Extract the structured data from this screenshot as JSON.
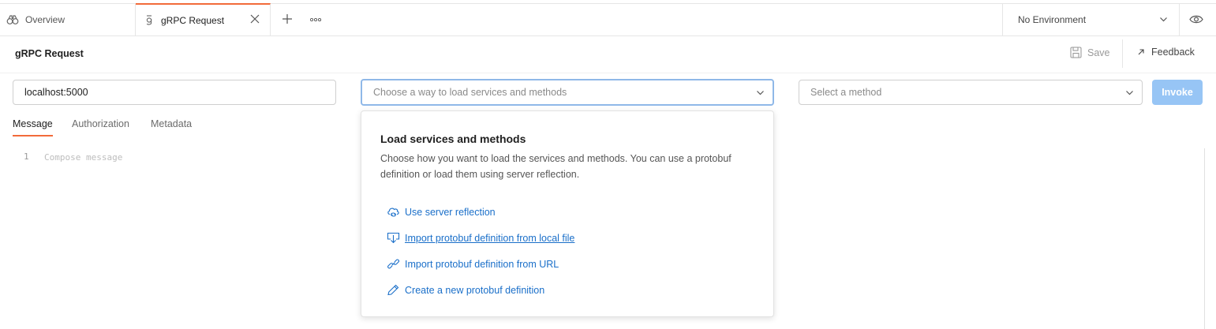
{
  "tabs": {
    "overview_label": "Overview",
    "active_label": "gRPC Request"
  },
  "environment": {
    "selected": "No Environment"
  },
  "request": {
    "title": "gRPC Request",
    "save_label": "Save",
    "feedback_label": "Feedback",
    "url_value": "localhost:5000",
    "load_placeholder": "Choose a way to load services and methods",
    "method_placeholder": "Select a method",
    "invoke_label": "Invoke"
  },
  "subtabs": [
    "Message",
    "Authorization",
    "Metadata"
  ],
  "editor": {
    "line_number": "1",
    "placeholder": "Compose message"
  },
  "dropdown": {
    "title": "Load services and methods",
    "description": "Choose how you want to load the services and methods. You can use a protobuf definition or load them using server reflection.",
    "options": [
      {
        "label": "Use server reflection",
        "icon": "cloud-sync-icon"
      },
      {
        "label": "Import protobuf definition from local file",
        "icon": "import-file-icon"
      },
      {
        "label": "Import protobuf definition from URL",
        "icon": "link-icon"
      },
      {
        "label": "Create a new protobuf definition",
        "icon": "pencil-icon"
      }
    ]
  },
  "colors": {
    "accent": "#f26b3a",
    "link": "#1a6fc9",
    "invoke_bg": "#97c5f5",
    "focus_border": "#8fb8e8"
  }
}
